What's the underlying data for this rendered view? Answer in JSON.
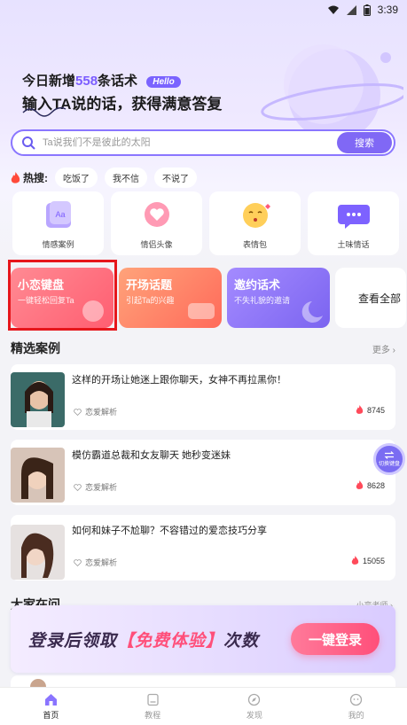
{
  "status_bar": {
    "time": "3:39"
  },
  "hero": {
    "line1_prefix": "今日新增",
    "line1_count": "558",
    "line1_suffix": "条话术",
    "hello_badge": "Hello",
    "line2": "输入TA说的话，获得满意答复"
  },
  "search": {
    "placeholder": "Ta说我们不是彼此的太阳",
    "button_label": "搜索"
  },
  "hot_search": {
    "label": "热搜:",
    "chips": [
      "吃饭了",
      "我不信",
      "不说了"
    ]
  },
  "categories": [
    {
      "label": "情感案例",
      "icon": "aa-book-icon"
    },
    {
      "label": "情侣头像",
      "icon": "heart-chat-icon"
    },
    {
      "label": "表情包",
      "icon": "kiss-emoji-icon"
    },
    {
      "label": "土味情话",
      "icon": "chat-bubble-icon"
    }
  ],
  "tools": [
    {
      "title": "小恋键盘",
      "subtitle": "一键轻松回复Ta",
      "color": "#ff5e71"
    },
    {
      "title": "开场话题",
      "subtitle": "引起Ta的兴趣",
      "color": "#ff6a5a"
    },
    {
      "title": "邀约话术",
      "subtitle": "不失礼貌的邀请",
      "color": "#7b64f0"
    },
    {
      "title": "查看全部"
    }
  ],
  "featured": {
    "title": "精选案例",
    "more": "更多 ›",
    "cases": [
      {
        "title": "这样的开场让她迷上跟你聊天，女神不再拉黑你！",
        "tag": "恋爱解析",
        "count": "8745"
      },
      {
        "title": "模仿霸道总裁和女友聊天 她秒变迷妹",
        "tag": "恋爱解析",
        "count": "8628"
      },
      {
        "title": "如何和妹子不尬聊？不容错过的爱恋技巧分享",
        "tag": "恋爱解析",
        "count": "15055"
      }
    ]
  },
  "switch_button": {
    "label": "切换键盘"
  },
  "section2": {
    "title": "大家在问",
    "more": "小恋老师 ›"
  },
  "banner": {
    "text_prefix": "登录后领取",
    "text_highlight": "【免费体验】",
    "text_suffix": "次数",
    "button_label": "一键登录"
  },
  "tabbar": [
    {
      "label": "首页",
      "icon": "home-icon",
      "active": true
    },
    {
      "label": "教程",
      "icon": "book-icon",
      "active": false
    },
    {
      "label": "发现",
      "icon": "compass-icon",
      "active": false
    },
    {
      "label": "我的",
      "icon": "profile-icon",
      "active": false
    }
  ],
  "colors": {
    "accent": "#7b5cff",
    "highlight_box": "#e6161b"
  }
}
